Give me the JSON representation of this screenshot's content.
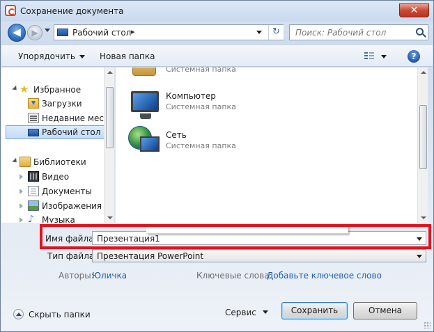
{
  "window": {
    "title": "Сохранение документа",
    "close_glyph": "✕"
  },
  "nav": {
    "back_glyph": "◀",
    "forward_glyph": "▶"
  },
  "address": {
    "path": "Рабочий стол",
    "separator": "▸",
    "refresh_glyph": "↻"
  },
  "search": {
    "placeholder": "Поиск: Рабочий стол"
  },
  "toolbar": {
    "organize_label": "Упорядочить",
    "new_folder_label": "Новая папка",
    "help_glyph": "?"
  },
  "navpane": {
    "favorites": {
      "label": "Избранное",
      "icon": "star-icon"
    },
    "favorite_items": [
      {
        "label": "Загрузки",
        "icon": "downloads-icon"
      },
      {
        "label": "Недавние места",
        "icon": "recent-places-icon"
      },
      {
        "label": "Рабочий стол",
        "icon": "desktop-icon",
        "selected": true
      }
    ],
    "libraries": {
      "label": "Библиотеки",
      "icon": "library-icon"
    },
    "library_items": [
      {
        "label": "Видео",
        "icon": "video-icon"
      },
      {
        "label": "Документы",
        "icon": "documents-icon"
      },
      {
        "label": "Изображения",
        "icon": "pictures-icon"
      },
      {
        "label": "Музыка",
        "icon": "music-icon"
      }
    ]
  },
  "content": {
    "partial_item": {
      "type": "Системная папка"
    },
    "items": [
      {
        "name": "Компьютер",
        "type": "Системная папка",
        "icon": "computer-icon"
      },
      {
        "name": "Сеть",
        "type": "Системная папка",
        "icon": "network-icon"
      }
    ]
  },
  "form": {
    "filename_label": "Имя файла:",
    "filename_value": "Презентация1",
    "filetype_label": "Тип файла:",
    "filetype_value": "Презентация PowerPoint",
    "authors_label": "Авторы:",
    "authors_value": "Юличка",
    "keywords_label": "Ключевые слова:",
    "keywords_value": "Добавьте ключевое слово"
  },
  "footer": {
    "hide_folders_label": "Скрыть папки",
    "service_label": "Сервис",
    "save_label": "Сохранить",
    "cancel_label": "Отмена"
  },
  "colors": {
    "highlight": "#e0141e",
    "link": "#1a5fb4",
    "selection": "#c1dcfc"
  }
}
